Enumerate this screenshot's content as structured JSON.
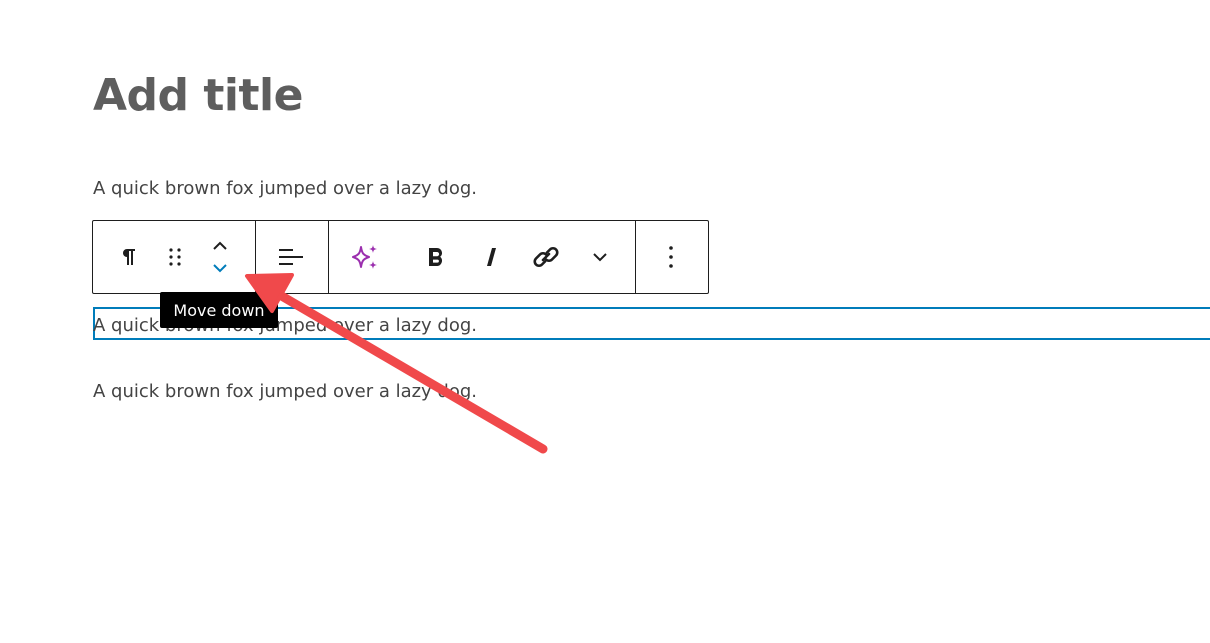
{
  "editor": {
    "title_placeholder": "Add title",
    "paragraphs": [
      "A quick brown fox jumped over a lazy dog.",
      "A quick brown fox jumped over a lazy dog.",
      "A quick brown fox jumped over a lazy dog."
    ]
  },
  "toolbar": {
    "buttons": [
      {
        "name": "paragraph-block-type",
        "icon": "pilcrow-icon"
      },
      {
        "name": "drag-handle",
        "icon": "drag-handle-icon"
      },
      {
        "name": "move-up",
        "icon": "chevron-up-icon"
      },
      {
        "name": "move-down",
        "icon": "chevron-down-icon"
      },
      {
        "name": "align",
        "icon": "align-left-icon"
      },
      {
        "name": "ai-assistant",
        "icon": "sparkles-icon"
      },
      {
        "name": "bold",
        "icon": "bold-icon"
      },
      {
        "name": "italic",
        "icon": "italic-icon"
      },
      {
        "name": "link",
        "icon": "link-icon"
      },
      {
        "name": "more-rich-text",
        "icon": "chevron-down-icon"
      },
      {
        "name": "options",
        "icon": "more-vertical-icon"
      }
    ]
  },
  "tooltip": {
    "text": "Move down"
  },
  "colors": {
    "selection_blue": "#007cba",
    "ai_purple": "#9b2fae",
    "annotation_arrow": "#f0494b",
    "tooltip_bg": "#000000"
  }
}
